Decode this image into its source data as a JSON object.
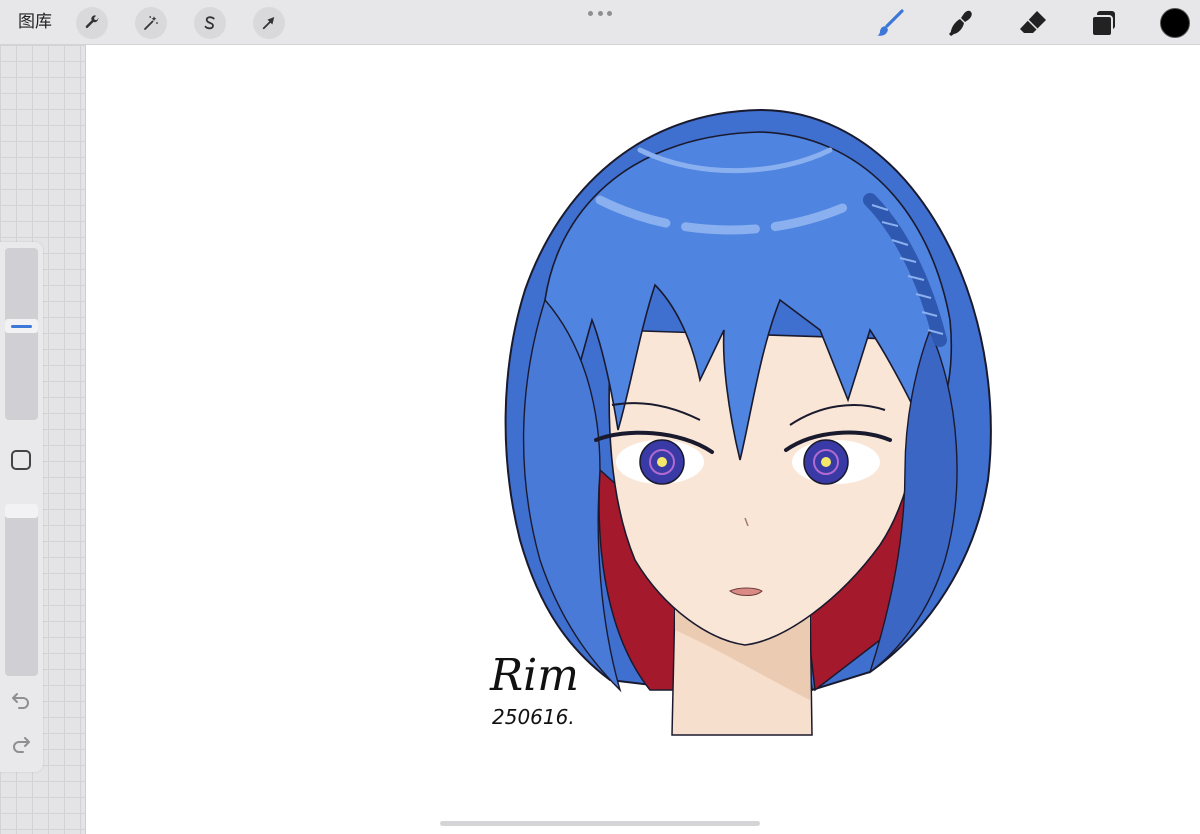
{
  "toolbar": {
    "gallery_label": "图库",
    "left_tools": [
      {
        "name": "actions",
        "icon": "wrench-icon"
      },
      {
        "name": "adjustments",
        "icon": "magic-wand-icon"
      },
      {
        "name": "selection",
        "icon": "selection-s-icon"
      },
      {
        "name": "transform",
        "icon": "arrow-cursor-icon"
      }
    ],
    "right_tools": [
      {
        "name": "brush",
        "icon": "brush-icon",
        "active": true
      },
      {
        "name": "smudge",
        "icon": "smudge-icon",
        "active": false
      },
      {
        "name": "eraser",
        "icon": "eraser-icon",
        "active": false
      },
      {
        "name": "layers",
        "icon": "layers-icon",
        "active": false
      }
    ],
    "current_color": "#000000",
    "accent_color": "#3b78d8"
  },
  "sidebar": {
    "brush_size_level": 0.55,
    "brush_opacity_level": 1.0,
    "buttons": [
      "modify-square-icon",
      "undo-icon",
      "redo-icon"
    ]
  },
  "canvas": {
    "signature_name": "Rim",
    "signature_date": "250616.",
    "palette": {
      "hair": "#4f84e0",
      "hair_shadow": "#3c66c4",
      "hair_highlight": "#8ab0ef",
      "hair_inner": "#a5192c",
      "skin": "#f9e6d6",
      "skin_shadow": "#eed3be",
      "eye_iris": "#3a3aa6",
      "eye_glow": "#f3e86a",
      "lips": "#d98a84"
    }
  }
}
